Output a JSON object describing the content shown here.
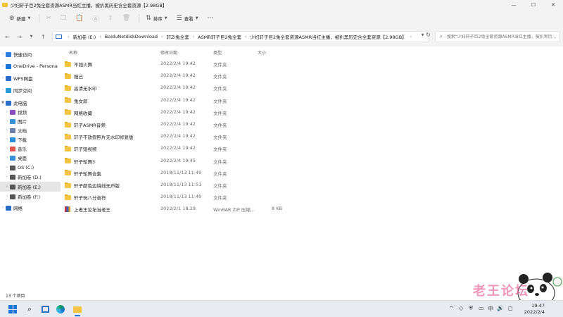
{
  "window": {
    "title": "少妇轩子巨2兔全套资源ASMR当红主播，被扒黑历史含全套资源【2.98GB】",
    "controls": [
      "—",
      "☐",
      "✕"
    ]
  },
  "toolbar": {
    "new_label": "新建",
    "sort_label": "排序",
    "view_label": "查看",
    "more_label": "···"
  },
  "address": {
    "crumbs": [
      "新加卷 (E:)",
      "BaiduNetdiskDownload",
      "轩Zi兔全套",
      "ASMR轩子巨2兔全套",
      "少妇轩子巨2兔全套资源ASMR当红主播，被扒黑历史含全套资源【2.98GB】"
    ],
    "search_placeholder": "搜索\"少妇轩子巨2兔全套资源ASMR当红主播，被扒黑历..."
  },
  "nav": {
    "items": [
      {
        "label": "快速访问",
        "icon": "star-icon",
        "color": "#2f7de1",
        "indent": 0
      },
      {
        "label": "OneDrive - Persona",
        "icon": "cloud-icon",
        "color": "#1a73d9",
        "indent": 0
      },
      {
        "label": "WPS网盘",
        "icon": "cloud-drive-icon",
        "color": "#2a6dc9",
        "indent": 0
      },
      {
        "label": "同步空间",
        "icon": "sync-icon",
        "color": "#2a9bd6",
        "indent": 0
      },
      {
        "label": "此电脑",
        "icon": "computer-icon",
        "color": "#2a6dc9",
        "indent": 0
      },
      {
        "label": "视频",
        "icon": "video-icon",
        "color": "#8a4dbf",
        "indent": 1
      },
      {
        "label": "图片",
        "icon": "picture-icon",
        "color": "#3a8fd6",
        "indent": 1
      },
      {
        "label": "文档",
        "icon": "document-icon",
        "color": "#6b7fa8",
        "indent": 1
      },
      {
        "label": "下载",
        "icon": "download-icon",
        "color": "#2a8bd6",
        "indent": 1
      },
      {
        "label": "音乐",
        "icon": "music-icon",
        "color": "#e0564f",
        "indent": 1
      },
      {
        "label": "桌面",
        "icon": "desktop-icon",
        "color": "#3a8fd6",
        "indent": 1
      },
      {
        "label": "OS (C:)",
        "icon": "drive-icon",
        "color": "#555555",
        "indent": 1
      },
      {
        "label": "新加卷 (D:)",
        "icon": "drive-icon",
        "color": "#555555",
        "indent": 1
      },
      {
        "label": "新加卷 (E:)",
        "icon": "drive-icon",
        "color": "#555555",
        "indent": 1
      },
      {
        "label": "新加卷 (F:)",
        "icon": "drive-icon",
        "color": "#555555",
        "indent": 1
      },
      {
        "label": "网络",
        "icon": "network-icon",
        "color": "#2a6dc9",
        "indent": 0
      }
    ]
  },
  "columns": {
    "name": "名称",
    "date": "修改日期",
    "type": "类型",
    "size": "大小"
  },
  "files": [
    {
      "name": "不如火舞",
      "date": "2022/2/4 19:42",
      "type": "文件夹",
      "size": "",
      "kind": "folder"
    },
    {
      "name": "妲己",
      "date": "2022/2/4 19:42",
      "type": "文件夹",
      "size": "",
      "kind": "folder"
    },
    {
      "name": "高清无水印",
      "date": "2022/2/4 19:42",
      "type": "文件夹",
      "size": "",
      "kind": "folder"
    },
    {
      "name": "兔女郎",
      "date": "2022/2/4 19:42",
      "type": "文件夹",
      "size": "",
      "kind": "folder"
    },
    {
      "name": "网络收藏",
      "date": "2022/2/4 19:42",
      "type": "文件夹",
      "size": "",
      "kind": "folder"
    },
    {
      "name": "轩子ASMR音频",
      "date": "2022/2/4 19:42",
      "type": "文件夹",
      "size": "",
      "kind": "folder"
    },
    {
      "name": "轩子不放假照片无水印修复版",
      "date": "2022/2/4 19:42",
      "type": "文件夹",
      "size": "",
      "kind": "folder"
    },
    {
      "name": "轩子短视频",
      "date": "2022/2/4 19:42",
      "type": "文件夹",
      "size": "",
      "kind": "folder"
    },
    {
      "name": "轩子轮舞3",
      "date": "2022/2/4 19:45",
      "type": "文件夹",
      "size": "",
      "kind": "folder"
    },
    {
      "name": "轩子轮舞合集",
      "date": "2018/11/13 11:49",
      "type": "文件夹",
      "size": "",
      "kind": "folder"
    },
    {
      "name": "轩子颜色边境线无声版",
      "date": "2018/11/13 11:51",
      "type": "文件夹",
      "size": "",
      "kind": "folder"
    },
    {
      "name": "轩子玩八分音符",
      "date": "2018/11/13 11:49",
      "type": "文件夹",
      "size": "",
      "kind": "folder"
    },
    {
      "name": "上老王论坛当老王",
      "date": "2022/2/1 18:29",
      "type": "WinRAR ZIP 压缩...",
      "size": "8 KB",
      "kind": "zip"
    }
  ],
  "status": {
    "item_count": "13 个项目"
  },
  "taskbar": {
    "clock_time": "19:47",
    "clock_date": "2022/2/4",
    "tray_icons": [
      "^",
      "◇",
      "⛨",
      "▭",
      "中",
      "🔊",
      "◻"
    ]
  },
  "overlay": {
    "watermark": "老王论坛"
  },
  "colors": {
    "accent": "#1a73d9",
    "folder": "#f4c442",
    "selected": "#e5e5e5"
  }
}
